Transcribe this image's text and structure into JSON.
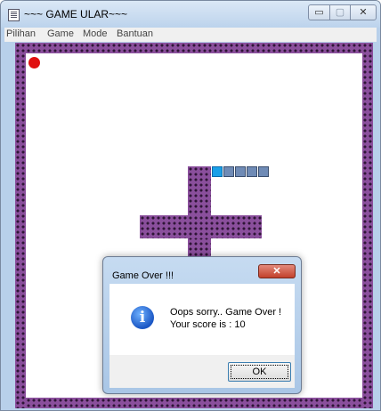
{
  "window": {
    "title": "~~~ GAME ULAR~~~",
    "minimize_glyph": "▭",
    "maximize_glyph": "▢",
    "close_glyph": "✕"
  },
  "menu": {
    "items": [
      "Pilihan",
      "Game",
      "Mode",
      "Bantuan"
    ]
  },
  "game": {
    "colors": {
      "wall": "#8a4f9c",
      "snake_body": "#6f8bb6",
      "snake_head": "#1aa0e8",
      "food": "#e01010"
    }
  },
  "dialog": {
    "title": "Game Over !!!",
    "close_glyph": "✕",
    "icon": "info-icon",
    "icon_glyph": "i",
    "message_line1": "Oops sorry.. Game Over !",
    "message_line2": "Your score is : 10",
    "ok_label": "OK"
  }
}
